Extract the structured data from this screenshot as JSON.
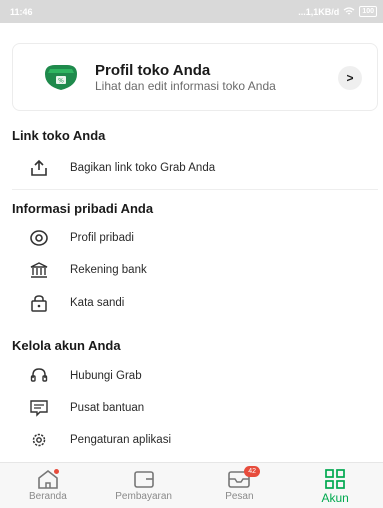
{
  "status_bar": {
    "time": "11:46",
    "network": "...1,1KB/d",
    "battery": "100"
  },
  "profile_card": {
    "title": "Profil toko Anda",
    "subtitle": "Lihat dan edit informasi toko Anda",
    "chevron": ">"
  },
  "sections": {
    "link": {
      "title": "Link toko Anda",
      "items": [
        {
          "label": "Bagikan link toko Grab Anda",
          "icon": "share-upload-icon"
        }
      ]
    },
    "personal": {
      "title": "Informasi pribadi Anda",
      "items": [
        {
          "label": "Profil pribadi",
          "icon": "personal-profile-icon"
        },
        {
          "label": "Rekening bank",
          "icon": "bank-icon"
        },
        {
          "label": "Kata sandi",
          "icon": "lock-icon"
        }
      ]
    },
    "manage": {
      "title": "Kelola akun Anda",
      "items": [
        {
          "label": "Hubungi Grab",
          "icon": "headset-icon"
        },
        {
          "label": "Pusat bantuan",
          "icon": "help-center-icon"
        },
        {
          "label": "Pengaturan aplikasi",
          "icon": "settings-gear-icon"
        }
      ]
    }
  },
  "bottom_nav": {
    "items": [
      {
        "label": "Beranda",
        "icon": "home-icon"
      },
      {
        "label": "Pembayaran",
        "icon": "wallet-icon"
      },
      {
        "label": "Pesan",
        "icon": "inbox-icon",
        "badge": "42"
      },
      {
        "label": "Akun",
        "icon": "grid-icon",
        "active": true
      }
    ]
  },
  "colors": {
    "accent": "#00a94f",
    "badge": "#e74c3c",
    "brand_dark_green": "#1f8a4c"
  }
}
